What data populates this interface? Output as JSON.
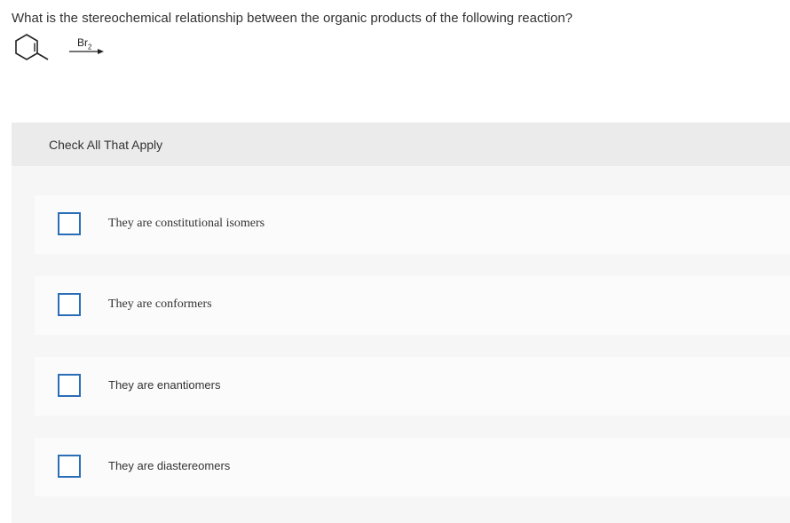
{
  "question": {
    "text": "What is the stereochemical relationship between the organic products of the following reaction?"
  },
  "reaction": {
    "reagent_symbol": "Br",
    "reagent_subscript": "2"
  },
  "answer": {
    "instruction": "Check All That Apply",
    "options": [
      {
        "label": "They are constitutional isomers",
        "checked": false
      },
      {
        "label": "They are conformers",
        "checked": false
      },
      {
        "label": "They are enantiomers",
        "checked": false
      },
      {
        "label": "They are diastereomers",
        "checked": false
      }
    ]
  },
  "colors": {
    "checkbox_border": "#2a6eb5",
    "panel_background": "#f6f6f6",
    "instruction_bar": "#ebebeb"
  }
}
